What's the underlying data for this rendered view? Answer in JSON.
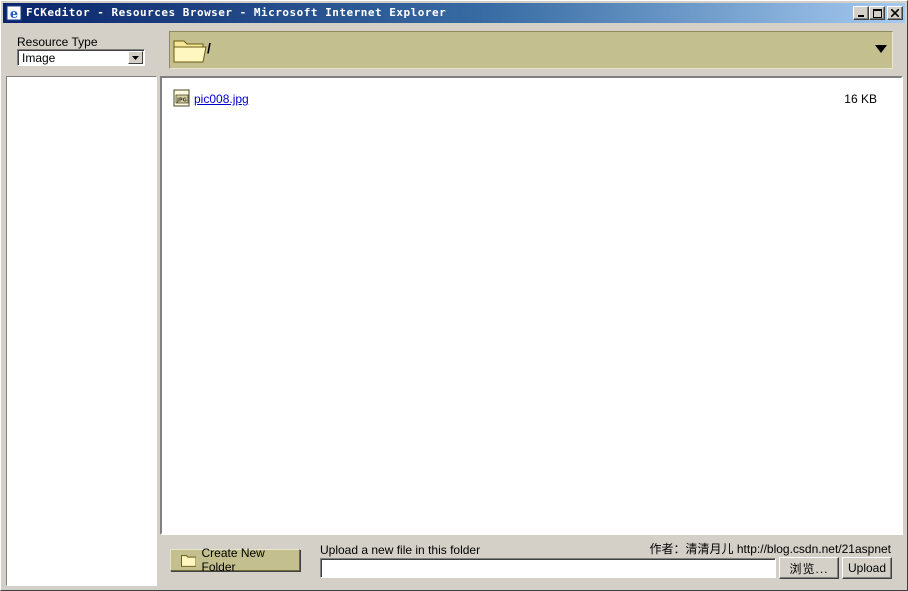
{
  "window": {
    "title": "FCKeditor - Resources Browser - Microsoft Internet Explorer"
  },
  "resource_type": {
    "label": "Resource Type",
    "selected": "Image"
  },
  "path_bar": {
    "current_path": "/"
  },
  "files": [
    {
      "name": "pic008.jpg",
      "size": "16 KB",
      "icon": "jpg-file-icon"
    }
  ],
  "bottom": {
    "create_folder_label": "Create New Folder",
    "upload_label": "Upload a new file in this folder",
    "author": "作者：清清月儿 http://blog.csdn.net/21aspnet",
    "upload_value": "",
    "browse_label": "浏览...",
    "upload_button_label": "Upload"
  },
  "colors": {
    "title_bar_start": "#0a246a",
    "title_bar_end": "#a6caf0",
    "path_bar": "#c3bf8e",
    "window_face": "#d4d0c8",
    "link": "#0000cc"
  }
}
